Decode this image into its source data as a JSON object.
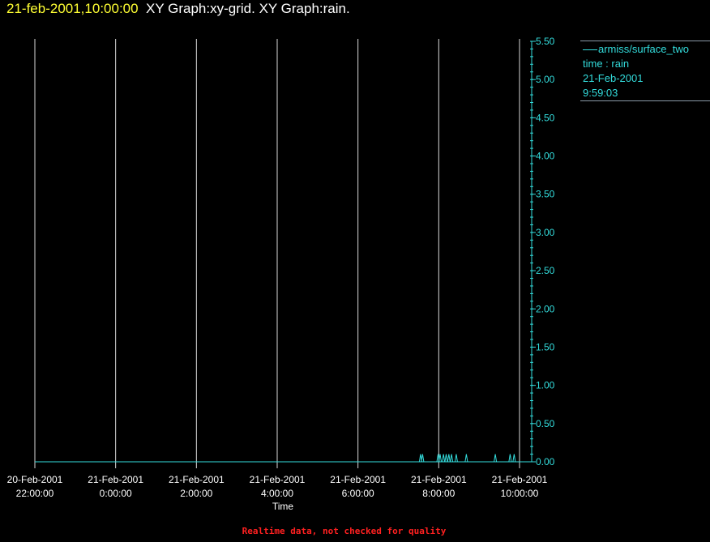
{
  "header": {
    "timestamp": "21-feb-2001,10:00:00",
    "graph_titles": "XY Graph:xy-grid.  XY Graph:rain."
  },
  "legend": {
    "series_name": "armiss/surface_two",
    "line1": "time : rain",
    "line2": "21-Feb-2001",
    "line3": "9:59:03"
  },
  "footer": {
    "note": "Realtime data, not checked for quality"
  },
  "colors": {
    "background": "#000000",
    "timestamp": "#ffff33",
    "title": "#ffffff",
    "series": "#33dddd",
    "grid": "#d8d8d8",
    "footer": "#ff2020"
  },
  "chart_data": {
    "type": "line",
    "xlabel": "Time",
    "ylabel": "",
    "grid": "vertical lines at x ticks",
    "y_axis_side": "right",
    "legend_placement": "top-right",
    "xlim": [
      "2001-02-20 22:00",
      "2001-02-21 10:00"
    ],
    "ylim": [
      0,
      5.5
    ],
    "x_ticks": [
      {
        "date": "20-Feb-2001",
        "time": "22:00:00"
      },
      {
        "date": "21-Feb-2001",
        "time": "0:00:00"
      },
      {
        "date": "21-Feb-2001",
        "time": "2:00:00"
      },
      {
        "date": "21-Feb-2001",
        "time": "4:00:00"
      },
      {
        "date": "21-Feb-2001",
        "time": "6:00:00"
      },
      {
        "date": "21-Feb-2001",
        "time": "8:00:00"
      },
      {
        "date": "21-Feb-2001",
        "time": "10:00:00"
      }
    ],
    "y_ticks": [
      "0.00",
      "0.50",
      "1.00",
      "1.50",
      "2.00",
      "2.50",
      "3.00",
      "3.50",
      "4.00",
      "4.50",
      "5.00",
      "5.50"
    ],
    "series": [
      {
        "name": "armiss/surface_two",
        "points": [
          {
            "x": "2001-02-20 22:00",
            "y": 0.0
          },
          {
            "x": "2001-02-21 07:33",
            "y": 0.1
          },
          {
            "x": "2001-02-21 07:36",
            "y": 0.1
          },
          {
            "x": "2001-02-21 07:59",
            "y": 0.1
          },
          {
            "x": "2001-02-21 08:02",
            "y": 0.1
          },
          {
            "x": "2001-02-21 08:07",
            "y": 0.1
          },
          {
            "x": "2001-02-21 08:11",
            "y": 0.1
          },
          {
            "x": "2001-02-21 08:15",
            "y": 0.1
          },
          {
            "x": "2001-02-21 08:19",
            "y": 0.1
          },
          {
            "x": "2001-02-21 08:26",
            "y": 0.1
          },
          {
            "x": "2001-02-21 08:41",
            "y": 0.1
          },
          {
            "x": "2001-02-21 09:24",
            "y": 0.1
          },
          {
            "x": "2001-02-21 09:46",
            "y": 0.1
          },
          {
            "x": "2001-02-21 09:52",
            "y": 0.1
          },
          {
            "x": "2001-02-21 09:59",
            "y": 0.0
          }
        ]
      }
    ]
  }
}
